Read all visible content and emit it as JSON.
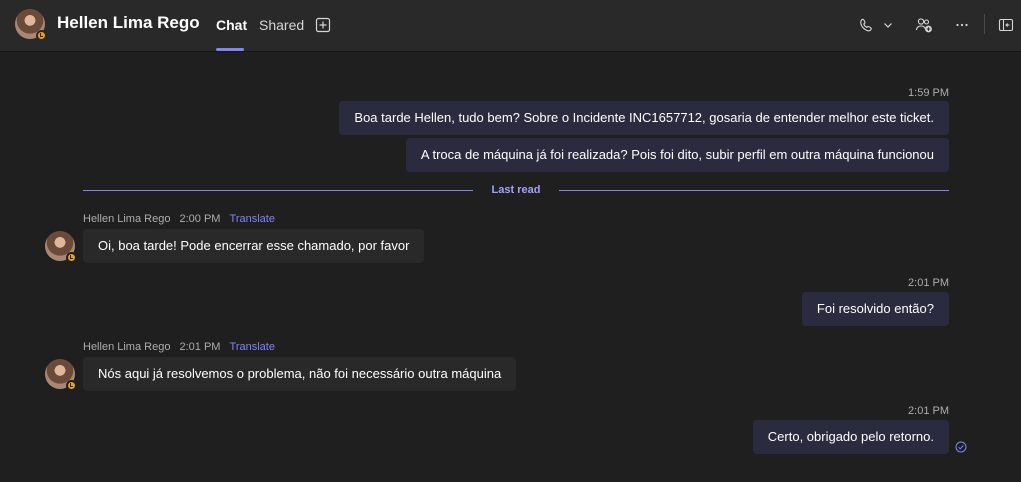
{
  "header": {
    "contact_name": "Hellen Lima Rego",
    "tabs": [
      {
        "label": "Chat",
        "active": true
      },
      {
        "label": "Shared",
        "active": false
      }
    ],
    "icons": [
      "add-tab-icon",
      "phone-icon",
      "chevron-down-icon",
      "add-people-icon",
      "more-options-icon",
      "pop-out-icon"
    ]
  },
  "colors": {
    "accent": "#7f85f5",
    "outgoing_bubble": "#2b2b40",
    "incoming_bubble": "#292929",
    "status_away": "#eaa300"
  },
  "messages": {
    "out1": {
      "time": "1:59 PM",
      "lines": [
        "Boa tarde Hellen, tudo bem? Sobre o Incidente INC1657712, gosaria de entender melhor este ticket.",
        "A troca de máquina já foi realizada? Pois foi dito, subir perfil em outra máquina funcionou"
      ]
    },
    "last_read_label": "Last read",
    "in1": {
      "sender": "Hellen Lima Rego",
      "time": "2:00 PM",
      "translate": "Translate",
      "text": "Oi, boa tarde! Pode encerrar esse chamado, por favor"
    },
    "out2": {
      "time": "2:01 PM",
      "text": "Foi resolvido então?"
    },
    "in2": {
      "sender": "Hellen Lima Rego",
      "time": "2:01 PM",
      "translate": "Translate",
      "text": "Nós aqui já resolvemos o problema, não foi necessário outra máquina"
    },
    "out3": {
      "time": "2:01 PM",
      "text": "Certo, obrigado pelo retorno.",
      "seen_icon": "seen-check-icon"
    }
  }
}
